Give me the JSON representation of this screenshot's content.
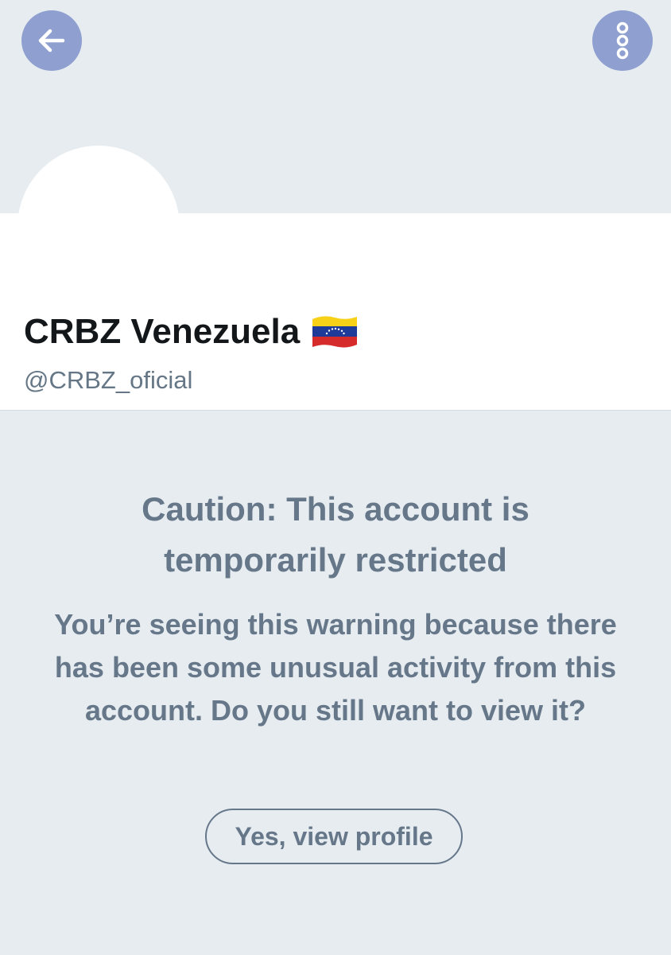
{
  "header": {
    "back_icon": "arrow-left-icon",
    "more_icon": "vertical-dots-icon",
    "accent_color": "#8e9fd0"
  },
  "profile": {
    "display_name": "CRBZ Venezuela",
    "flag_icon": "venezuela-flag-icon",
    "handle": "@CRBZ_oficial"
  },
  "warning": {
    "title": "Caution: This account is temporarily restricted",
    "body": "You’re seeing this warning because there has been some unusual activity from this account. Do you still want to view it?",
    "button_label": "Yes, view profile"
  }
}
